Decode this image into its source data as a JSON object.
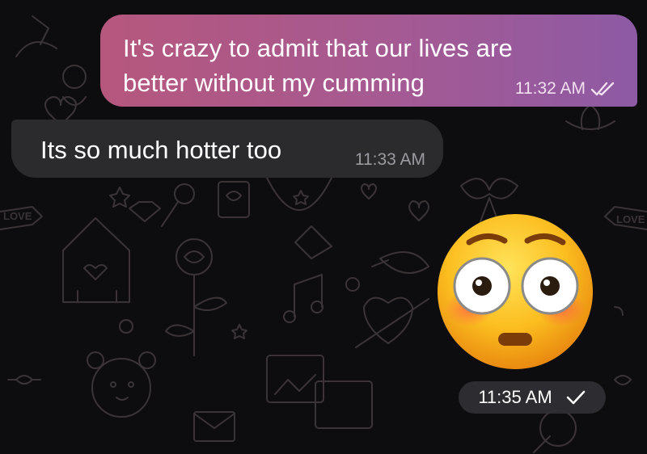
{
  "messages": {
    "outgoing": {
      "text_line1": "It's crazy to admit that our lives are",
      "text_line2": "better without my cumming",
      "time": "11:32 AM",
      "status_icon": "double-check-icon"
    },
    "incoming": {
      "text": "Its so much hotter too",
      "time": "11:33 AM"
    },
    "sticker": {
      "emoji": "flushed-face",
      "time": "11:35 AM",
      "status_icon": "single-check-icon"
    }
  },
  "background": {
    "wallpaper_labels": [
      "LOVE",
      "LOVE"
    ]
  }
}
